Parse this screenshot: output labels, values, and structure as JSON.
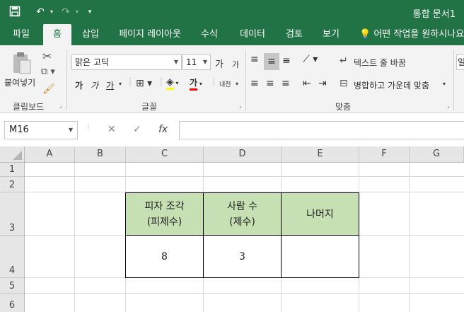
{
  "titlebar": {
    "title": "통합 문서1",
    "accent": "#217346"
  },
  "tabs": [
    {
      "label": "파일",
      "active": false
    },
    {
      "label": "홈",
      "active": true
    },
    {
      "label": "삽입",
      "active": false
    },
    {
      "label": "페이지 레이아웃",
      "active": false
    },
    {
      "label": "수식",
      "active": false
    },
    {
      "label": "데이터",
      "active": false
    },
    {
      "label": "검토",
      "active": false
    },
    {
      "label": "보기",
      "active": false
    }
  ],
  "tellme": "💡 어떤 작업을 원하시나요",
  "ribbon": {
    "clipboard": {
      "paste_label": "붙여넣기",
      "group_label": "클립보드"
    },
    "font": {
      "font_name": "맑은 고딕",
      "font_size": "11",
      "group_label": "글꼴",
      "bold": "가",
      "italic": "가",
      "underline": "가",
      "font_color_glyph": "가",
      "phonetic": "내천",
      "grow": "가",
      "shrink": "가"
    },
    "alignment": {
      "wrap_text": "텍스트 줄 바꿈",
      "merge_center": "병합하고 가운데 맞춤",
      "group_label": "맞춤"
    },
    "number": {
      "partial": "일"
    }
  },
  "formula_bar": {
    "name_box": "M16",
    "fx": "fx",
    "cancel": "✕",
    "enter": "✓",
    "value": ""
  },
  "sheet": {
    "columns": [
      "A",
      "B",
      "C",
      "D",
      "E",
      "F",
      "G"
    ],
    "rows": [
      "1",
      "2",
      "3",
      "4",
      "5",
      "6"
    ],
    "header_fill": "#c6e0b4",
    "table": {
      "headers": [
        "피자 조각\n(피제수)",
        "사람 수\n(제수)",
        "나머지"
      ],
      "values": [
        "8",
        "3",
        ""
      ]
    }
  }
}
